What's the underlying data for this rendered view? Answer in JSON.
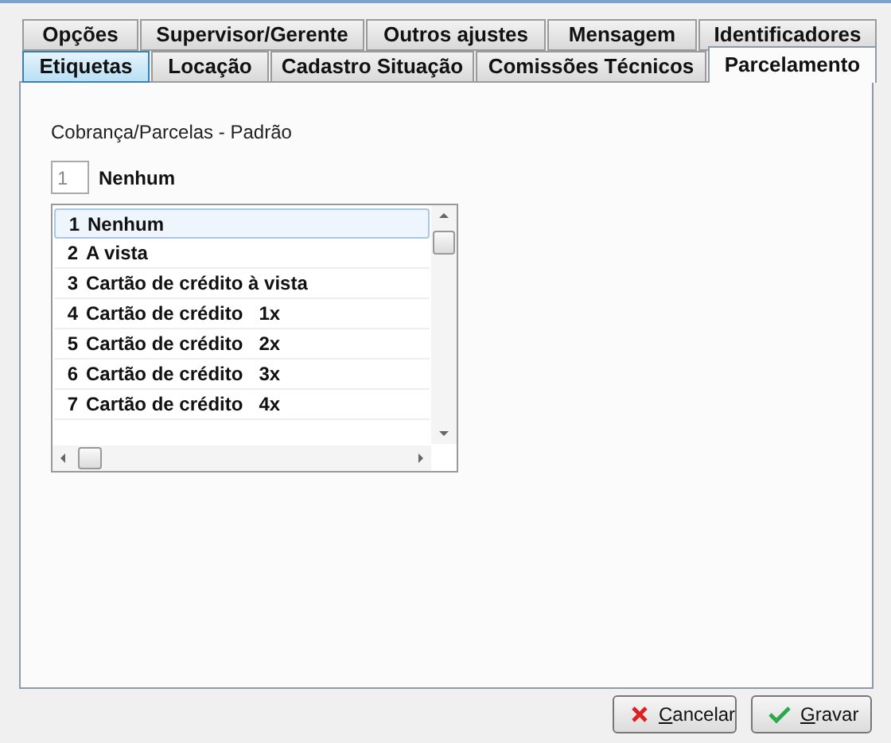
{
  "tabs_back_row": [
    {
      "label": "Opções",
      "selected": false,
      "highlighted": false
    },
    {
      "label": "Supervisor/Gerente",
      "selected": false,
      "highlighted": false
    },
    {
      "label": "Outros ajustes",
      "selected": false,
      "highlighted": false
    },
    {
      "label": "Mensagem",
      "selected": false,
      "highlighted": false
    },
    {
      "label": "Identificadores",
      "selected": false,
      "highlighted": false
    }
  ],
  "tabs_front_row": [
    {
      "label": "Etiquetas",
      "selected": false,
      "highlighted": true
    },
    {
      "label": "Locação",
      "selected": false,
      "highlighted": false
    },
    {
      "label": "Cadastro Situação",
      "selected": false,
      "highlighted": false
    },
    {
      "label": "Comissões Técnicos",
      "selected": false,
      "highlighted": false
    },
    {
      "label": "Parcelamento",
      "selected": true,
      "highlighted": false
    }
  ],
  "section_label": "Cobrança/Parcelas - Padrão",
  "code_field": {
    "value": "1"
  },
  "code_description": "Nenhum",
  "list": [
    {
      "number": "1",
      "text": "Nenhum",
      "selected": true
    },
    {
      "number": "2",
      "text": "A vista",
      "selected": false
    },
    {
      "number": "3",
      "text": "Cartão de crédito à vista",
      "selected": false
    },
    {
      "number": "4",
      "text": "Cartão de crédito   1x",
      "selected": false
    },
    {
      "number": "5",
      "text": "Cartão de crédito   2x",
      "selected": false
    },
    {
      "number": "6",
      "text": "Cartão de crédito   3x",
      "selected": false
    },
    {
      "number": "7",
      "text": "Cartão de crédito   4x",
      "selected": false
    }
  ],
  "buttons": [
    {
      "label": "Cancelar",
      "kind": "cancel",
      "mnemonic": true
    },
    {
      "label": "Gravar",
      "kind": "save",
      "mnemonic": true
    }
  ]
}
